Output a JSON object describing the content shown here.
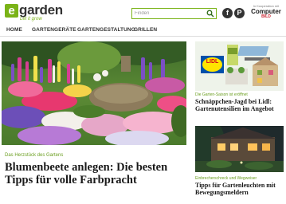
{
  "header": {
    "logo": {
      "mark": "e",
      "word": "garden",
      "tagline": "Let it grow"
    },
    "search": {
      "placeholder": "Finden",
      "icon": "search-icon"
    },
    "social": [
      {
        "name": "facebook-icon",
        "glyph": "f"
      },
      {
        "name": "pinterest-icon",
        "glyph": "P"
      }
    ],
    "partner": {
      "label": "In Kooperation mit",
      "logo_main": "Computer",
      "logo_sub": "BILD"
    }
  },
  "nav": {
    "items": [
      "HOME",
      "GARTENGERÄTE",
      "GARTENGESTALTUNG",
      "GRILLEN"
    ]
  },
  "main": {
    "kicker": "Das Herzstück des Gartens",
    "headline": "Blumenbeete anlegen: Die besten Tipps für volle Farbpracht"
  },
  "sidebar": {
    "cards": [
      {
        "kicker": "Die Garten-Saison ist eröffnet",
        "title": "Schnäppchen-Jagd bei Lidl: Gartenutensilien im Angebot",
        "badge": "LIDL"
      },
      {
        "kicker": "Einbrecherschreck und Wegweiser",
        "title": "Tipps für Gartenleuchten mit Bewegungsmeldern"
      }
    ]
  },
  "colors": {
    "accent": "#7ab317",
    "kicker": "#6a9e1f",
    "text": "#1a1a1a"
  }
}
